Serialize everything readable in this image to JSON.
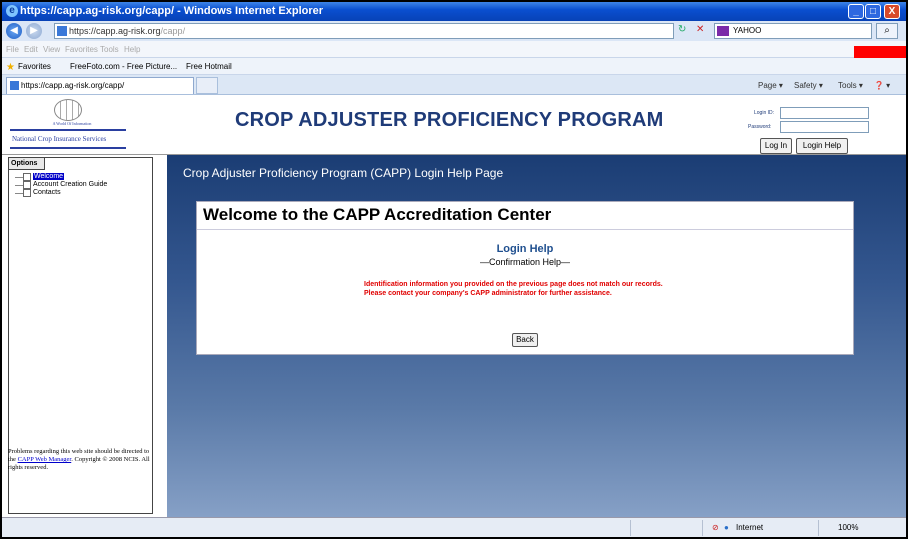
{
  "window": {
    "title": "https://capp.ag-risk.org/capp/ - Windows Internet Explorer",
    "minimize": "_",
    "maximize": "□",
    "close": "X"
  },
  "address": {
    "url_main": "https://capp.ag-risk.org",
    "url_rest": "/capp/",
    "search_value": "YAHOO",
    "back_glyph": "◀",
    "forward_glyph": "▶",
    "refresh_glyph": "↻",
    "stop_glyph": "✕",
    "search_glyph": "⌕"
  },
  "menu": {
    "items": [
      "File",
      "Edit",
      "View",
      "Favorites",
      "Tools",
      "Help"
    ]
  },
  "favorites": {
    "label": "Favorites",
    "links": [
      "FreeFoto.com - Free Picture...",
      "Free Hotmail"
    ]
  },
  "tabs": [
    {
      "label": "https://capp.ag-risk.org/capp/"
    }
  ],
  "commandbar": {
    "page": "Page ▾",
    "safety": "Safety ▾",
    "tools": "Tools ▾",
    "help": "❓ ▾"
  },
  "header": {
    "logo_tagline": "A World Of Information",
    "logo_name": "National Crop Insurance Services",
    "title": "CROP ADJUSTER PROFICIENCY PROGRAM",
    "login_id_label": "Login ID:",
    "password_label": "Password:",
    "login_id_value": "",
    "password_value": "",
    "login_button": "Log In",
    "login_help_button": "Login Help"
  },
  "sidebar": {
    "tab_label": "Options",
    "items": [
      {
        "label": "Welcome",
        "selected": true
      },
      {
        "label": "Account Creation Guide",
        "selected": false
      },
      {
        "label": "Contacts",
        "selected": false
      }
    ],
    "footer_text_1": "Problems regarding this web site should be directed to the ",
    "footer_link": "CAPP Web Manager",
    "footer_text_2": ". Copyright © 2008 NCIS. All rights reserved."
  },
  "main": {
    "page_title": "Crop Adjuster Proficiency Program (CAPP) Login Help Page",
    "card_title": "Welcome to the CAPP Accreditation Center",
    "section_title": "Login Help",
    "section_subtitle": "—Confirmation Help—",
    "error_message": "Identification information you provided on the previous page does not match our records. Please contact your company's CAPP administrator for further assistance.",
    "back_button": "Back"
  },
  "statusbar": {
    "zone": "Internet",
    "zoom": "100%"
  },
  "colors": {
    "title_blue": "#1f3b78",
    "error_red": "#e00000",
    "highlight": "#ff0000"
  }
}
